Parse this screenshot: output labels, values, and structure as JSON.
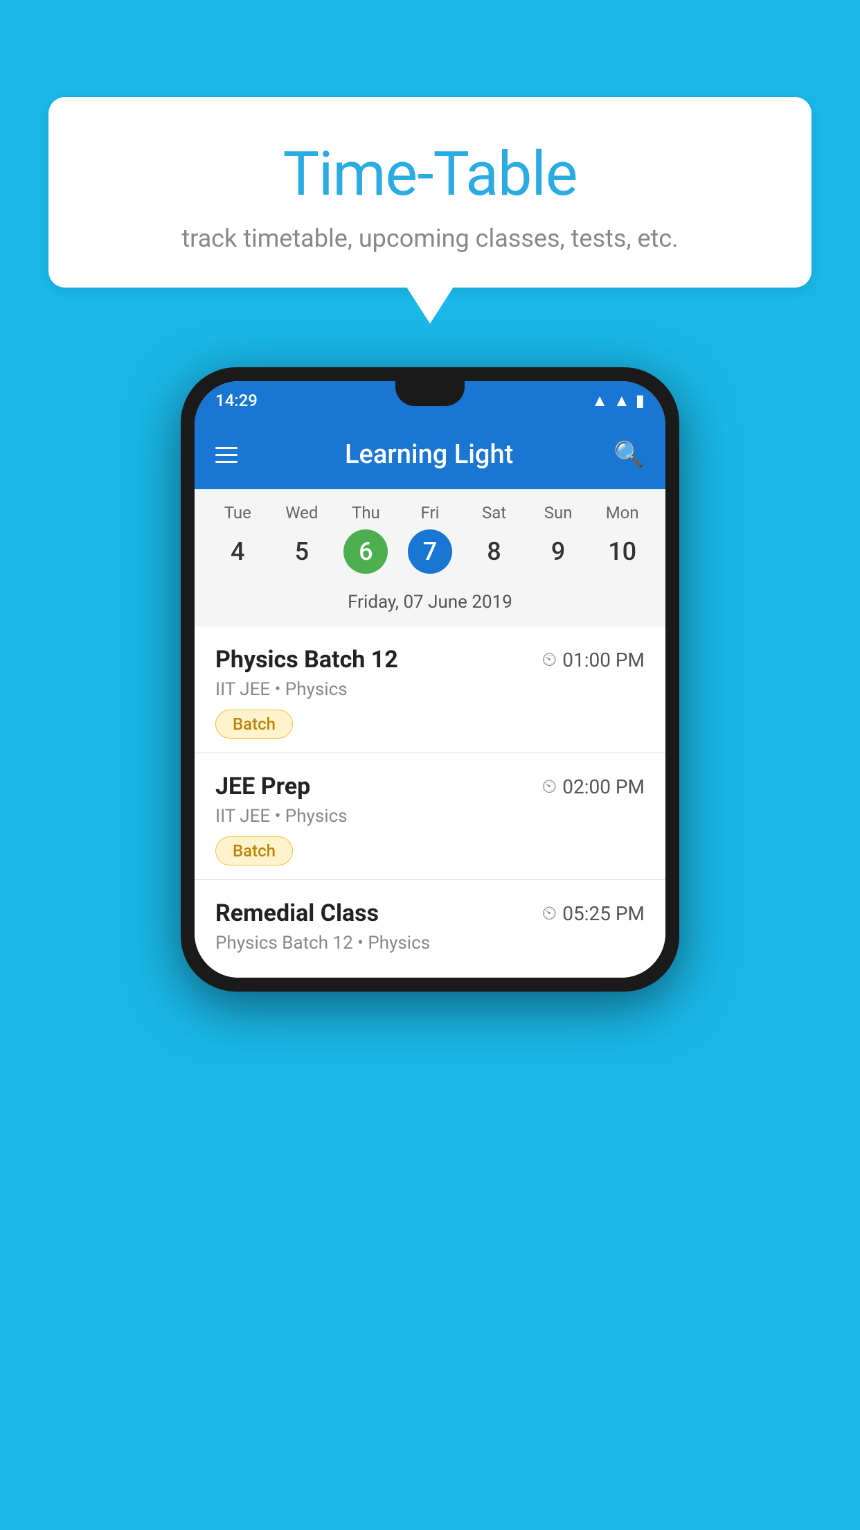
{
  "background": {
    "color": "#1ab8e8"
  },
  "speech_bubble": {
    "title": "Time-Table",
    "subtitle": "track timetable, upcoming classes, tests, etc."
  },
  "phone": {
    "status_bar": {
      "time": "14:29"
    },
    "app_bar": {
      "title": "Learning Light",
      "hamburger_label": "menu",
      "search_label": "search"
    },
    "calendar": {
      "days": [
        {
          "label": "Tue",
          "number": "4",
          "state": "normal"
        },
        {
          "label": "Wed",
          "number": "5",
          "state": "normal"
        },
        {
          "label": "Thu",
          "number": "6",
          "state": "today"
        },
        {
          "label": "Fri",
          "number": "7",
          "state": "selected"
        },
        {
          "label": "Sat",
          "number": "8",
          "state": "normal"
        },
        {
          "label": "Sun",
          "number": "9",
          "state": "normal"
        },
        {
          "label": "Mon",
          "number": "10",
          "state": "normal"
        }
      ],
      "selected_date_label": "Friday, 07 June 2019"
    },
    "schedule": {
      "items": [
        {
          "title": "Physics Batch 12",
          "time": "01:00 PM",
          "subtitle": "IIT JEE • Physics",
          "badge": "Batch"
        },
        {
          "title": "JEE Prep",
          "time": "02:00 PM",
          "subtitle": "IIT JEE • Physics",
          "badge": "Batch"
        },
        {
          "title": "Remedial Class",
          "time": "05:25 PM",
          "subtitle": "Physics Batch 12 • Physics",
          "badge": null
        }
      ]
    }
  }
}
